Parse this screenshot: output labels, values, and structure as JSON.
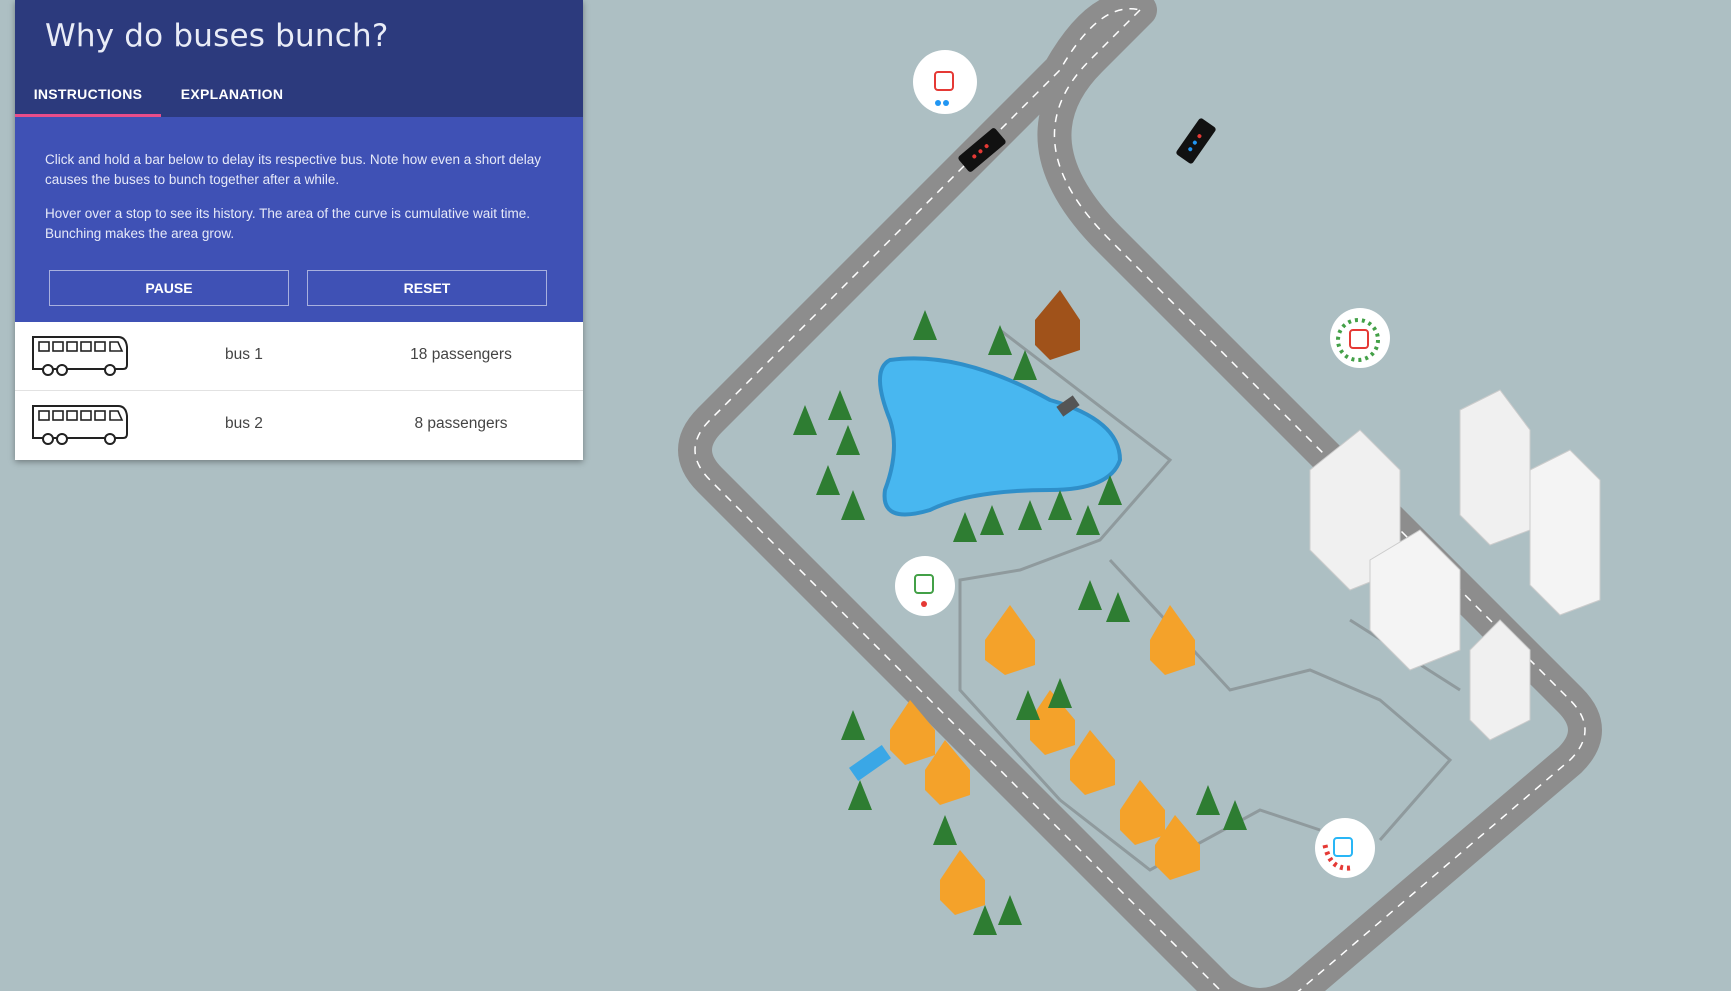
{
  "header": {
    "title": "Why do buses bunch?",
    "tabs": [
      {
        "label": "INSTRUCTIONS",
        "active": true
      },
      {
        "label": "EXPLANATION",
        "active": false
      }
    ]
  },
  "instructions": {
    "paragraphs": [
      "Click and hold a bar below to delay its respective bus. Note how even a short delay causes the buses to bunch together after a while.",
      "Hover over a stop to see its history. The area of the curve is cumulative wait time. Bunching makes the area grow."
    ],
    "buttons": {
      "pause": "PAUSE",
      "reset": "RESET"
    }
  },
  "buses": [
    {
      "name": "bus 1",
      "passengers": "18 passengers"
    },
    {
      "name": "bus 2",
      "passengers": "8 passengers"
    }
  ],
  "colors": {
    "header_bg": "#2c3a7d",
    "panel_bg": "#3f51b5",
    "tab_indicator": "#e94d8a",
    "map_bg": "#adbfc3",
    "road": "#8c8c8c",
    "lake": "#4ab5ee",
    "roof": "#f5a623",
    "tree": "#2e7d32"
  },
  "map": {
    "stops": [
      {
        "id": "stop-top",
        "waiting_color": "#2196f3",
        "icon_color": "#e53935"
      },
      {
        "id": "stop-right",
        "waiting_color": "#43a047",
        "icon_color": "#e53935"
      },
      {
        "id": "stop-left",
        "waiting_color": "#e53935",
        "icon_color": "#43a047"
      },
      {
        "id": "stop-bottom",
        "waiting_color": "#e53935",
        "icon_color": "#29b6f6"
      }
    ]
  }
}
